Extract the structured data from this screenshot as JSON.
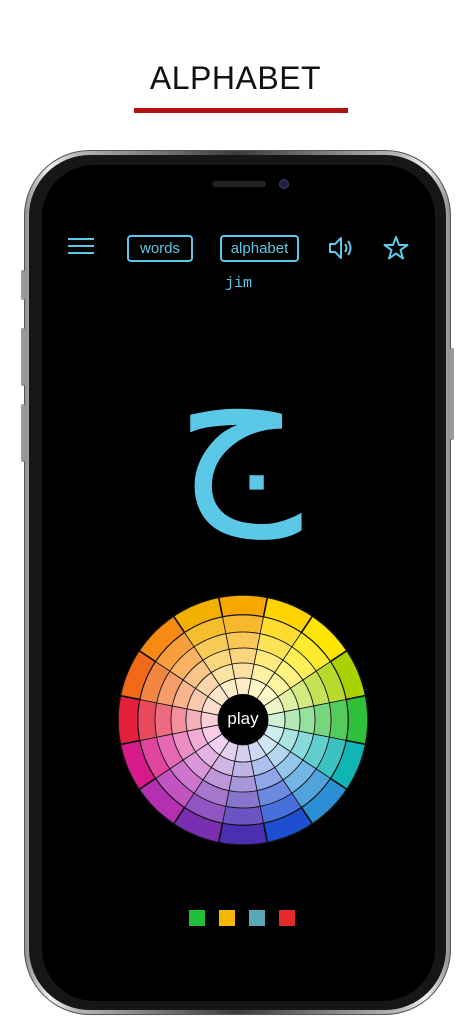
{
  "page": {
    "heading": "ALPHABET",
    "accent_color": "#b31212"
  },
  "app": {
    "accent_color": "#5bc8e8",
    "toolbar": {
      "menu_icon": "hamburger-menu-icon",
      "words_label": "words",
      "alphabet_label": "alphabet",
      "sound_icon": "speaker-icon",
      "favorite_icon": "star-outline-icon"
    },
    "letter": {
      "name": "jim",
      "glyph": "ج"
    },
    "wheel": {
      "play_label": "play",
      "segment_colors": [
        "#f7a800",
        "#ffd400",
        "#ffe600",
        "#a8d200",
        "#2fc03a",
        "#12b5b5",
        "#2b8fd6",
        "#1f4fd1",
        "#4b2fb3",
        "#7a2fb3",
        "#b52fb3",
        "#d81b8a",
        "#e4213c",
        "#f06a1a",
        "#f78a12",
        "#f4b000"
      ]
    },
    "swatches": [
      "#1fbf3a",
      "#f5b800",
      "#5aa8b5",
      "#e42a2a"
    ]
  }
}
